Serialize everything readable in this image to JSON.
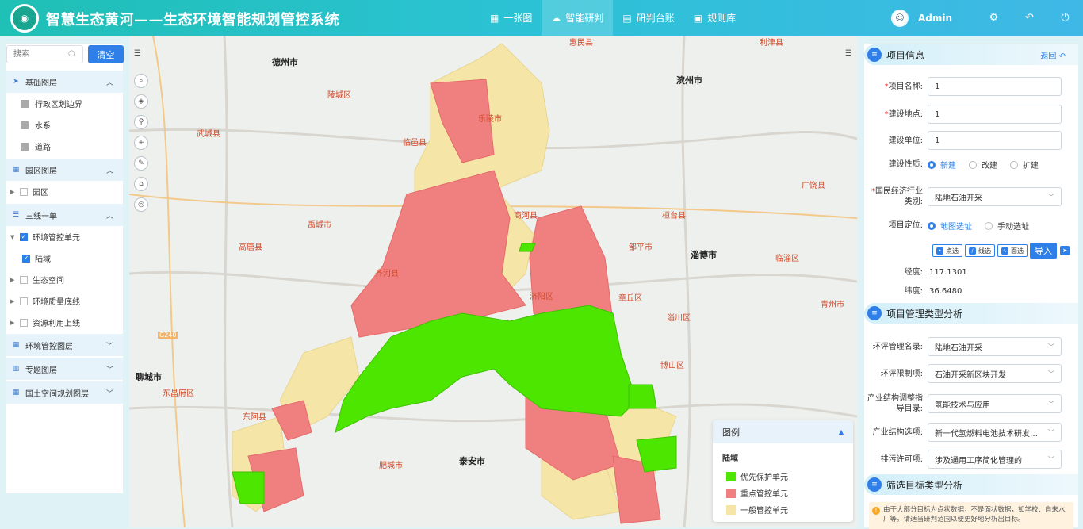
{
  "header": {
    "title": "智慧生态黄河——生态环境智能规划管控系统",
    "nav": [
      {
        "label": "一张图",
        "icon": "map-icon",
        "active": false
      },
      {
        "label": "智能研判",
        "icon": "cloud-icon",
        "active": true
      },
      {
        "label": "研判台账",
        "icon": "ledger-icon",
        "active": false
      },
      {
        "label": "规则库",
        "icon": "rules-icon",
        "active": false
      }
    ],
    "user": "Admin",
    "colors": {
      "gradient_start": "#1fc0b5",
      "gradient_end": "#3fb8e6"
    }
  },
  "left": {
    "search_placeholder": "搜索",
    "clear_label": "清空",
    "groups": {
      "base": "基础图层",
      "park": "园区图层",
      "three": "三线一单",
      "env": "环境管控图层",
      "topic": "专题图层",
      "land": "国土空间规划图层"
    },
    "base_items": [
      "行政区划边界",
      "水系",
      "道路"
    ],
    "park_items": [
      "园区"
    ],
    "three_items": {
      "unit": "环境管控单元",
      "land_area": "陆域",
      "eco": "生态空间",
      "quality": "环境质量底线",
      "resource": "资源利用上线"
    }
  },
  "map": {
    "labels": {
      "dezhou": "德州市",
      "binzhou": "滨州市",
      "zibo": "淄博市",
      "liaocheng": "聊城市",
      "taian": "泰安市",
      "linyi": "临邑县",
      "pingyuan": "陵城区",
      "yucheng": "禹城市",
      "qihe": "齐河县",
      "gaotang": "高唐县",
      "wucheng": "武城县",
      "dongea": "东阿县",
      "feicheng": "肥城市",
      "zouping": "邹平市",
      "huantai": "桓台县",
      "zhangqiu": "章丘区",
      "zichuan": "淄川区",
      "boshan": "博山区",
      "linzi": "临淄区",
      "qingzhou": "青州市",
      "guangrao": "广饶县",
      "huimin": "惠民县",
      "lijin": "利津县",
      "shanghe": "商河县",
      "jiyang": "济阳区",
      "dongchang": "东昌府区",
      "leling": "乐陵市",
      "road": "G240"
    },
    "legend": {
      "title": "图例",
      "subtitle": "陆域",
      "items": [
        {
          "label": "优先保护单元",
          "color": "#4de600"
        },
        {
          "label": "重点管控单元",
          "color": "#f08080"
        },
        {
          "label": "一般管控单元",
          "color": "#f5e6a8"
        }
      ]
    }
  },
  "right": {
    "project_info": {
      "title": "项目信息",
      "back": "返回",
      "name_label": "项目名称:",
      "name_value": "1",
      "site_label": "建设地点:",
      "site_value": "1",
      "unit_label": "建设单位:",
      "unit_value": "1",
      "nature_label": "建设性质:",
      "nature_options": [
        "新建",
        "改建",
        "扩建"
      ],
      "industry_label": "国民经济行业类别:",
      "industry_value": "陆地石油开采",
      "locate_label": "项目定位:",
      "locate_options": [
        "地图选址",
        "手动选址"
      ],
      "draw_tools": [
        "点选",
        "线选",
        "面选"
      ],
      "import_label": "导入",
      "lng_label": "经度:",
      "lng_value": "117.1301",
      "lat_label": "纬度:",
      "lat_value": "36.6480"
    },
    "mgmt": {
      "title": "项目管理类型分析",
      "eia_label": "环评管理名录:",
      "eia_value": "陆地石油开采",
      "limit_label": "环评限制项:",
      "limit_value": "石油开采新区块开发",
      "adjust_label": "产业结构调整指导目录:",
      "adjust_value": "氢能技术与应用",
      "option_label": "产业结构选项:",
      "option_value": "新一代氢燃料电池技术研发…",
      "permit_label": "排污许可项:",
      "permit_value": "涉及通用工序简化管理的"
    },
    "filter": {
      "title": "筛选目标类型分析",
      "note": "由于大部分目标为点状数据，不是面状数据，如学校、自来水厂等。请适当研判范围以便更好地分析出目标。"
    }
  }
}
